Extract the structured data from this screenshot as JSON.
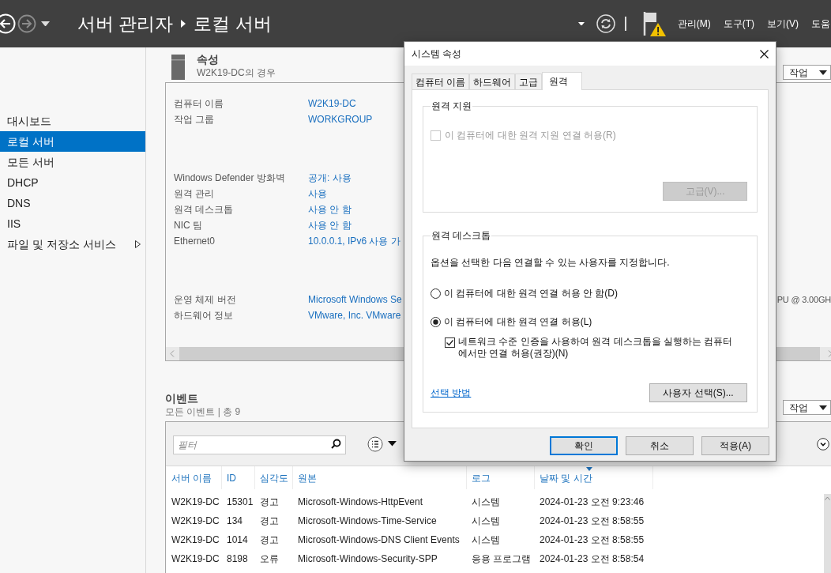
{
  "toolbar": {
    "title": "서버 관리자",
    "page": "로컬 서버",
    "menus": [
      "관리(M)",
      "도구(T)",
      "보기(V)",
      "도움"
    ]
  },
  "sidebar": {
    "items": [
      {
        "label": "대시보드",
        "selected": false,
        "expandable": false
      },
      {
        "label": "로컬 서버",
        "selected": true,
        "expandable": false
      },
      {
        "label": "모든 서버",
        "selected": false,
        "expandable": false
      },
      {
        "label": "DHCP",
        "selected": false,
        "expandable": false
      },
      {
        "label": "DNS",
        "selected": false,
        "expandable": false
      },
      {
        "label": "IIS",
        "selected": false,
        "expandable": false
      },
      {
        "label": "파일 및 저장소 서비스",
        "selected": false,
        "expandable": true
      }
    ]
  },
  "properties": {
    "title": "속성",
    "subtitle": "W2K19-DC의 경우",
    "task_button": "작업",
    "groups": [
      [
        {
          "label": "컴퓨터 이름",
          "value": "W2K19-DC"
        },
        {
          "label": "작업 그룹",
          "value": "WORKGROUP"
        }
      ],
      [
        {
          "label": "Windows Defender 방화벽",
          "value": "공개: 사용"
        },
        {
          "label": "원격 관리",
          "value": "사용"
        },
        {
          "label": "원격 데스크톱",
          "value": "사용 안 함"
        },
        {
          "label": "NIC 팀",
          "value": "사용 안 함"
        },
        {
          "label": "Ethernet0",
          "value": "10.0.0.1, IPv6 사용 가"
        }
      ],
      [
        {
          "label": "운영 체제 버전",
          "value": "Microsoft Windows Se",
          "side_value": "PU @ 3.00GH"
        },
        {
          "label": "하드웨어 정보",
          "value": "VMware, Inc. VMware"
        }
      ]
    ]
  },
  "events": {
    "title": "이벤트",
    "subtitle": "모든 이벤트 | 총 9",
    "task_button": "작업",
    "filter_placeholder": "필터",
    "columns": [
      {
        "label": "서버 이름",
        "sorted": false
      },
      {
        "label": "ID",
        "sorted": false
      },
      {
        "label": "심각도",
        "sorted": false
      },
      {
        "label": "원본",
        "sorted": false
      },
      {
        "label": "로그",
        "sorted": false
      },
      {
        "label": "날짜 및 시간",
        "sorted": true
      }
    ],
    "rows": [
      [
        "W2K19-DC",
        "15301",
        "경고",
        "Microsoft-Windows-HttpEvent",
        "시스템",
        "2024-01-23 오전 9:23:46"
      ],
      [
        "W2K19-DC",
        "134",
        "경고",
        "Microsoft-Windows-Time-Service",
        "시스템",
        "2024-01-23 오전 8:58:55"
      ],
      [
        "W2K19-DC",
        "1014",
        "경고",
        "Microsoft-Windows-DNS Client Events",
        "시스템",
        "2024-01-23 오전 8:58:55"
      ],
      [
        "W2K19-DC",
        "8198",
        "오류",
        "Microsoft-Windows-Security-SPP",
        "응용 프로그램",
        "2024-01-23 오전 8:58:54"
      ]
    ]
  },
  "dialog": {
    "title": "시스템 속성",
    "tabs": [
      {
        "label": "컴퓨터 이름",
        "selected": false
      },
      {
        "label": "하드웨어",
        "selected": false
      },
      {
        "label": "고급",
        "selected": false
      },
      {
        "label": "원격",
        "selected": true
      }
    ],
    "remote_assistance": {
      "title": "원격 지원",
      "checkbox": {
        "label": "이 컴퓨터에 대한 원격 지원 연결 허용(R)",
        "checked": false,
        "disabled": true
      },
      "advanced_button": {
        "label": "고급(V)...",
        "disabled": true
      }
    },
    "remote_desktop": {
      "title": "원격 데스크톱",
      "description": "옵션을 선택한 다음 연결할 수 있는 사용자를 지정합니다.",
      "options": [
        {
          "label": "이 컴퓨터에 대한 원격 연결 허용 안 함(D)",
          "selected": false
        },
        {
          "label": "이 컴퓨터에 대한 원격 연결 허용(L)",
          "selected": true
        }
      ],
      "nla": {
        "label": "네트워크 수준 인증을 사용하여 원격 데스크톱을 실행하는 컴퓨터에서만 연결 허용(권장)(N)",
        "checked": true
      },
      "help_link": "선택 방법",
      "select_users_button": "사용자 선택(S)..."
    },
    "buttons": [
      {
        "label": "확인",
        "default": true
      },
      {
        "label": "취소",
        "default": false
      },
      {
        "label": "적용(A)",
        "default": false
      }
    ]
  }
}
